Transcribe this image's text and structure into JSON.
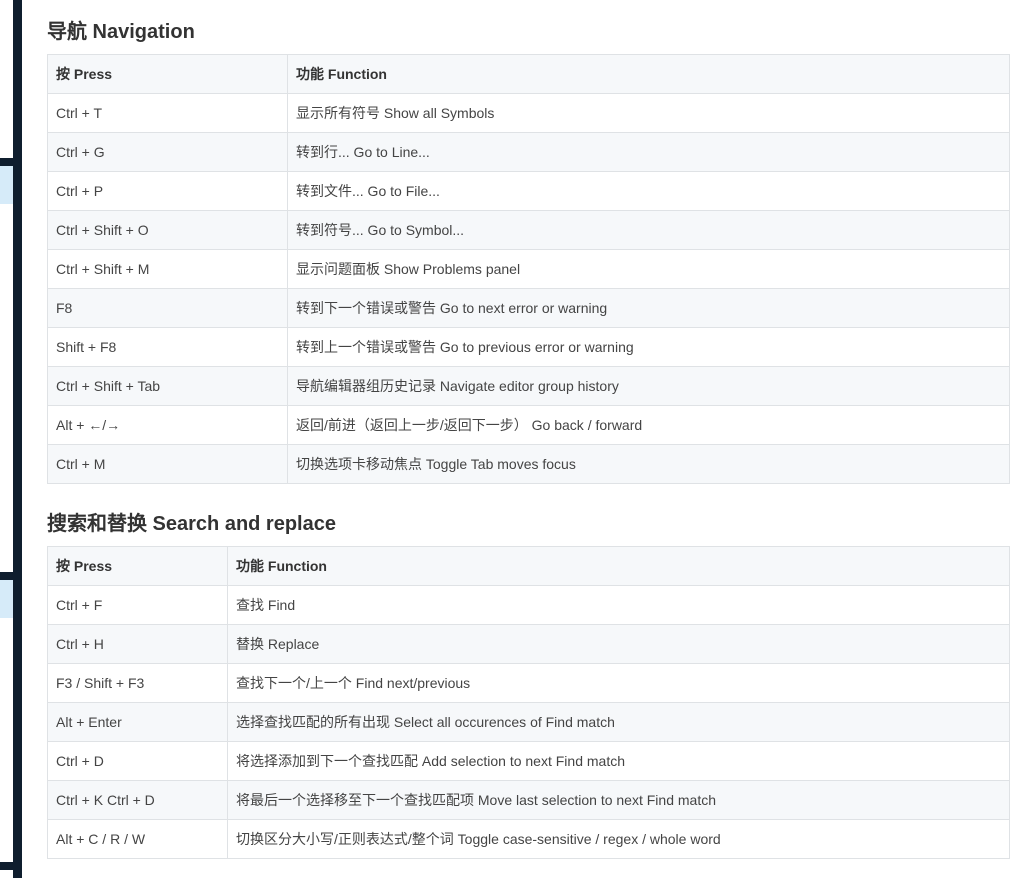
{
  "sections": [
    {
      "title": "导航 Navigation",
      "headers": [
        "按 Press",
        "功能 Function"
      ],
      "rows": [
        [
          "Ctrl + T",
          "显示所有符号 Show all Symbols"
        ],
        [
          "Ctrl + G",
          "转到行... Go to Line..."
        ],
        [
          "Ctrl + P",
          "转到文件... Go to File..."
        ],
        [
          "Ctrl + Shift + O",
          "转到符号... Go to Symbol..."
        ],
        [
          "Ctrl + Shift + M",
          "显示问题面板 Show Problems panel"
        ],
        [
          "F8",
          "转到下一个错误或警告 Go to next error or warning"
        ],
        [
          "Shift + F8",
          "转到上一个错误或警告 Go to previous error or warning"
        ],
        [
          "Ctrl + Shift + Tab",
          "导航编辑器组历史记录 Navigate editor group history"
        ],
        [
          "Alt + ←/→",
          "返回/前进（返回上一步/返回下一步） Go back / forward"
        ],
        [
          "Ctrl + M",
          "切换选项卡移动焦点 Toggle Tab moves focus"
        ]
      ]
    },
    {
      "title": "搜索和替换 Search and replace",
      "headers": [
        "按 Press",
        "功能 Function"
      ],
      "rows": [
        [
          "Ctrl + F",
          "查找 Find"
        ],
        [
          "Ctrl + H",
          "替换 Replace"
        ],
        [
          "F3 / Shift + F3",
          "查找下一个/上一个 Find next/previous"
        ],
        [
          "Alt + Enter",
          "选择查找匹配的所有出现 Select all occurences of Find match"
        ],
        [
          "Ctrl + D",
          "将选择添加到下一个查找匹配 Add selection to next Find match"
        ],
        [
          "Ctrl + K Ctrl + D",
          "将最后一个选择移至下一个查找匹配项 Move last selection to next Find match"
        ],
        [
          "Alt + C / R / W",
          "切换区分大小写/正则表达式/整个词 Toggle case-sensitive / regex / whole word"
        ]
      ]
    }
  ]
}
